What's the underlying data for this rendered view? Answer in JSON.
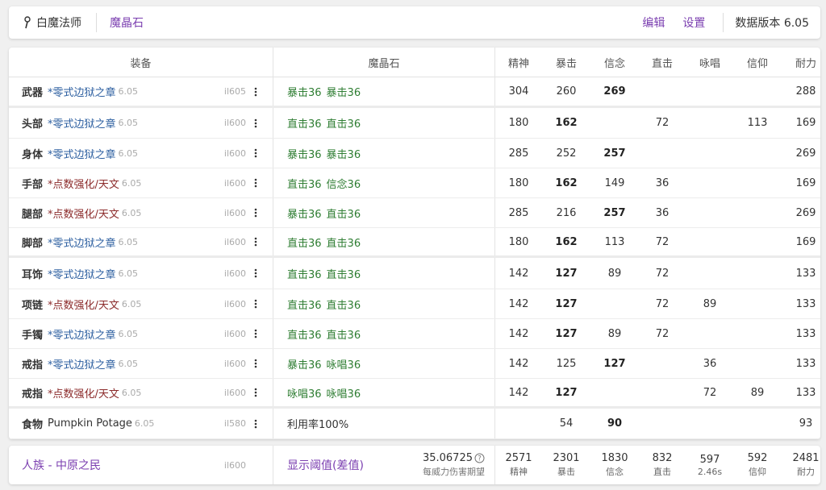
{
  "header": {
    "job": "白魔法师",
    "job_icon": "staff-icon",
    "tab": "魔晶石",
    "edit": "编辑",
    "settings": "设置",
    "version": "数据版本 6.05"
  },
  "columns": {
    "gear": "装备",
    "materia": "魔晶石",
    "stats": [
      "精神",
      "暴击",
      "信念",
      "直击",
      "咏唱",
      "信仰",
      "耐力"
    ]
  },
  "rows": [
    {
      "slot": "武器",
      "name": "*零式边狱之章",
      "ver": "6.05",
      "color": "blue",
      "ilvl": "il605",
      "materia": [
        "暴击36",
        "暴击36"
      ],
      "stats": [
        "304",
        "260",
        "269",
        "",
        "",
        "",
        "288"
      ],
      "bold": 2
    },
    {
      "slot": "头部",
      "name": "*零式边狱之章",
      "ver": "6.05",
      "color": "blue",
      "ilvl": "il600",
      "materia": [
        "直击36",
        "直击36"
      ],
      "stats": [
        "180",
        "162",
        "",
        "72",
        "",
        "113",
        "169"
      ],
      "bold": 1
    },
    {
      "slot": "身体",
      "name": "*零式边狱之章",
      "ver": "6.05",
      "color": "blue",
      "ilvl": "il600",
      "materia": [
        "暴击36",
        "暴击36"
      ],
      "stats": [
        "285",
        "252",
        "257",
        "",
        "",
        "",
        "269"
      ],
      "bold": 2
    },
    {
      "slot": "手部",
      "name": "*点数强化/天文",
      "ver": "6.05",
      "color": "red",
      "ilvl": "il600",
      "materia": [
        "直击36",
        "信念36"
      ],
      "stats": [
        "180",
        "162",
        "149",
        "36",
        "",
        "",
        "169"
      ],
      "bold": 1
    },
    {
      "slot": "腿部",
      "name": "*点数强化/天文",
      "ver": "6.05",
      "color": "red",
      "ilvl": "il600",
      "materia": [
        "暴击36",
        "直击36"
      ],
      "stats": [
        "285",
        "216",
        "257",
        "36",
        "",
        "",
        "269"
      ],
      "bold": 2
    },
    {
      "slot": "脚部",
      "name": "*零式边狱之章",
      "ver": "6.05",
      "color": "blue",
      "ilvl": "il600",
      "materia": [
        "直击36",
        "直击36"
      ],
      "stats": [
        "180",
        "162",
        "113",
        "72",
        "",
        "",
        "169"
      ],
      "bold": 1
    },
    {
      "slot": "耳饰",
      "name": "*零式边狱之章",
      "ver": "6.05",
      "color": "blue",
      "ilvl": "il600",
      "materia": [
        "直击36",
        "直击36"
      ],
      "stats": [
        "142",
        "127",
        "89",
        "72",
        "",
        "",
        "133"
      ],
      "bold": 1
    },
    {
      "slot": "项链",
      "name": "*点数强化/天文",
      "ver": "6.05",
      "color": "red",
      "ilvl": "il600",
      "materia": [
        "直击36",
        "直击36"
      ],
      "stats": [
        "142",
        "127",
        "",
        "72",
        "89",
        "",
        "133"
      ],
      "bold": 1
    },
    {
      "slot": "手镯",
      "name": "*零式边狱之章",
      "ver": "6.05",
      "color": "blue",
      "ilvl": "il600",
      "materia": [
        "直击36",
        "直击36"
      ],
      "stats": [
        "142",
        "127",
        "89",
        "72",
        "",
        "",
        "133"
      ],
      "bold": 1
    },
    {
      "slot": "戒指",
      "name": "*零式边狱之章",
      "ver": "6.05",
      "color": "blue",
      "ilvl": "il600",
      "materia": [
        "暴击36",
        "咏唱36"
      ],
      "stats": [
        "142",
        "125",
        "127",
        "",
        "36",
        "",
        "133"
      ],
      "bold": 2
    },
    {
      "slot": "戒指",
      "name": "*点数强化/天文",
      "ver": "6.05",
      "color": "red",
      "ilvl": "il600",
      "materia": [
        "咏唱36",
        "咏唱36"
      ],
      "stats": [
        "142",
        "127",
        "",
        "",
        "72",
        "89",
        "133"
      ],
      "bold": 1
    },
    {
      "slot": "食物",
      "name": "Pumpkin Potage",
      "ver": "6.05",
      "color": "black",
      "ilvl": "il580",
      "materia": [
        "利用率100%"
      ],
      "stats": [
        "",
        "54",
        "90",
        "",
        "",
        "",
        "93"
      ],
      "bold": 2
    }
  ],
  "footer": {
    "race": "人族 - 中原之民",
    "ilvl": "il600",
    "threshold": "显示阈值(差值)",
    "damage": "35.06725",
    "damage_label": "每威力伤害期望",
    "totals": [
      {
        "v": "2571",
        "l": "精神"
      },
      {
        "v": "2301",
        "l": "暴击"
      },
      {
        "v": "1830",
        "l": "信念"
      },
      {
        "v": "832",
        "l": "直击"
      },
      {
        "v": "597",
        "l": "2.46s"
      },
      {
        "v": "592",
        "l": "信仰"
      },
      {
        "v": "2481",
        "l": "耐力"
      }
    ]
  },
  "colors": {
    "accent": "#7b3fb0",
    "materia": "#2e7d32",
    "gear_blue": "#2d5fa0",
    "gear_red": "#8b2a2a"
  }
}
